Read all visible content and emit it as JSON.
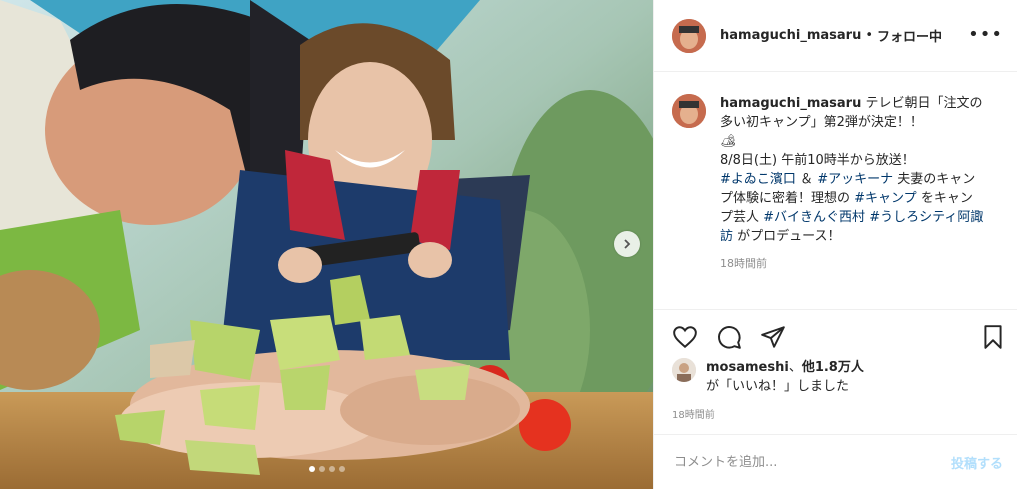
{
  "header": {
    "username": "hamaguchi_masaru",
    "separator": "•",
    "follow_status": "フォロー中",
    "more_icon": "ellipsis-icon"
  },
  "caption": {
    "username": "hamaguchi_masaru",
    "line1": "テレビ朝日「注文の多い初キャンプ」第2弾が決定！！",
    "emoji": "🏕",
    "line2": "8/8日(土) 午前10時半から放送！",
    "tag1": "#よゐこ濱口",
    "amp": "＆",
    "tag2": "#アッキーナ",
    "text3": "夫妻のキャンプ体験に密着！理想の",
    "tag3": "#キャンプ",
    "text4": "をキャンプ芸人",
    "tag4": "#バイきんぐ西村",
    "tag5": "#うしろシティ阿諏訪",
    "text5": "がプロデュース！",
    "time": "18時間前"
  },
  "likes": {
    "user": "mosameshi",
    "sep": "、",
    "others": "他1.8万人",
    "suffix": "が「いいね！」しました"
  },
  "post_time": "18時間前",
  "comment": {
    "placeholder": "コメントを追加...",
    "post_label": "投稿する"
  },
  "carousel": {
    "total": 4,
    "active": 1
  },
  "colors": {
    "link": "#00376b",
    "muted": "#8e8e8e",
    "post_button_disabled": "#b2dffc"
  }
}
